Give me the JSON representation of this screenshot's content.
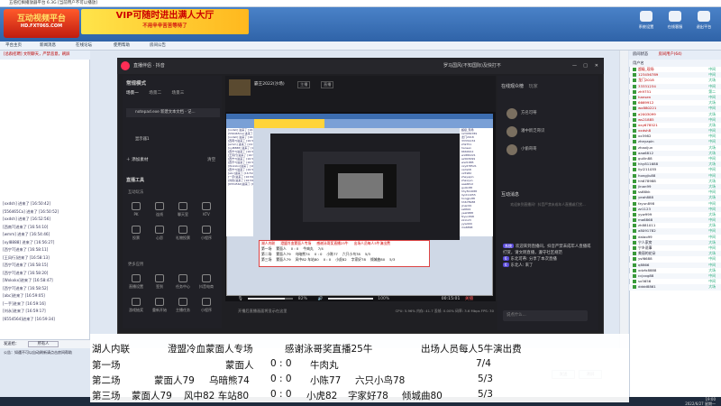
{
  "titlebar": {
    "text": "五倍红枫播放器平台 6.3G [当前用户不可以播放]"
  },
  "logo": {
    "text": "互动视频平台",
    "sub": "HD.FXT065.COM"
  },
  "banner": {
    "line1": "VIP可随时进出满人大厅",
    "line2": "不用辛辛苦苦等待了"
  },
  "top_buttons": [
    {
      "label": "系统设置"
    },
    {
      "label": "在线客服"
    },
    {
      "label": "退出平台"
    }
  ],
  "toolbar2": [
    {
      "label": "平台主页"
    },
    {
      "label": "新闻消息"
    },
    {
      "label": "在线论坛"
    },
    {
      "label": "使用帮助"
    },
    {
      "label": "房间公告"
    }
  ],
  "left": {
    "header": "[总群招聘] 文明聊天，严禁恶意，刷屏",
    "lines": [
      "[xxdsh] 进来了 [16:50:42]",
      "[556465Ca] 进来了 [16:50:52]",
      "[xxdsh] 进来了 [16:52:56]",
      "[西南7]进来了 [16:54:10]",
      "[wmm] 进来了 [16:54:46]",
      "[xyl8888] 进来了 [16:56:27]",
      "[西宁7]进来了 [16:58:11]",
      "[王风行]进来了 [16:58:13]",
      "[西宁7]进来了 [16:58:15]",
      "[西宁7]进来了 [16:58:20]",
      "[Wxkxkx]进来了 [16:58:47]",
      "[西宁7]进来了 [16:58:52]",
      "[abc]进来了 [16:59:05]",
      "[一手]进来了 [16:59:16]",
      "[刘永]进来了 [16:59:17]",
      "[6554564]进来了 [16:59:34]"
    ],
    "speaker_label": "发送给：",
    "speaker_value": "所有人",
    "info_label": "公告：如遇不可以自动刷新请点击房间帮助"
  },
  "right": {
    "tabs": [
      "房间状态",
      "房间用户(64)"
    ],
    "user_header": "用户名",
    "users": [
      {
        "name": "超级_现场",
        "status": "中间"
      },
      {
        "name": "123456789",
        "status": "中间"
      },
      {
        "name": "龙门2018",
        "status": "大场"
      },
      {
        "name": "33331234",
        "status": "中间"
      },
      {
        "name": "zh9751",
        "status": "第二"
      },
      {
        "name": "hansen",
        "status": "中间"
      },
      {
        "name": "6669912",
        "status": "大场"
      },
      {
        "name": "wx880221",
        "status": "中间"
      },
      {
        "name": "a2003099",
        "status": "大场"
      },
      {
        "name": "ws21885",
        "status": "中间"
      },
      {
        "name": "xxy678521",
        "status": "大场"
      },
      {
        "name": "xxdsh8",
        "status": "中间"
      },
      {
        "name": "xx5982",
        "status": "中间"
      },
      {
        "name": "zheyapin",
        "status": "中间"
      },
      {
        "name": "zhaxijun",
        "status": "大场"
      },
      {
        "name": "aaa6812",
        "status": "大场"
      },
      {
        "name": "guilin88",
        "status": "中间"
      },
      {
        "name": "hhy811688",
        "status": "大场"
      },
      {
        "name": "liyi211055",
        "status": "中间"
      },
      {
        "name": "hongjiu88",
        "status": "中间"
      },
      {
        "name": "hh678988",
        "status": "大场"
      },
      {
        "name": "jinan99",
        "status": "大场"
      },
      {
        "name": "ss66kk",
        "status": "中间"
      },
      {
        "name": "yeah888",
        "status": "大场"
      },
      {
        "name": "fzyun898",
        "status": "中间"
      },
      {
        "name": "zz1123",
        "status": "中间"
      },
      {
        "name": "yyw999",
        "status": "大场"
      },
      {
        "name": "ma6868",
        "status": "中间"
      },
      {
        "name": "zh881011",
        "status": "大场"
      },
      {
        "name": "a8091782",
        "status": "中间"
      },
      {
        "name": "dalao99",
        "status": "中间"
      },
      {
        "name": "宁人家房",
        "status": "大场"
      },
      {
        "name": "宁乡说事",
        "status": "中间"
      },
      {
        "name": "美丽的花朵",
        "status": "大场"
      },
      {
        "name": "ysf6688",
        "status": "中间"
      },
      {
        "name": "q8866",
        "status": "中间"
      },
      {
        "name": "xdzfx8888",
        "status": "大场"
      },
      {
        "name": "ccjxxg88",
        "status": "中间"
      },
      {
        "name": "sx5656",
        "status": "中间"
      },
      {
        "name": "dddd8861",
        "status": "大场"
      }
    ],
    "send_button": "发送",
    "clear_button": "清屏",
    "date": "2022/6/27 星期一",
    "time": "19:00"
  },
  "app": {
    "name": "直播伴侣 · 抖音",
    "user": "罗马国风(不知国际)及快打不",
    "left": {
      "scene_title": "常规模式",
      "scene_tabs": [
        "场景一",
        "场景二",
        "场景三"
      ],
      "sources": [
        "notepad.exe 新建文本文档 - 记...",
        "显示器1"
      ],
      "add_source": "添加素材",
      "clear": "清空",
      "tools_title": "直播工具",
      "interact_title": "互动玩法",
      "tools": [
        "PK",
        "连线",
        "聊天室",
        "KTV",
        "投票",
        "心愿",
        "礼物投票",
        "小程序"
      ],
      "more_title": "更多应用",
      "more": [
        "直播设置",
        "签到",
        "任务中心",
        "抖音电商",
        "游戏抽奖",
        "重新开始",
        "主播任务",
        "小程序"
      ]
    },
    "preview": {
      "room_name": "霸王2022(沙场)",
      "tag1": "主播",
      "tag2": "直播"
    },
    "controls": {
      "mic": "82%",
      "speaker": "100%",
      "timer": "00:15:01",
      "end": "关播"
    },
    "stats": "CPU: 5.96%  内存: 41.7  丢帧: 0.00%  码率: 3.6 Mbps  FPS: 30",
    "camera_hint": "开播后直播画面将显示在这里",
    "right": {
      "viewers_title": "在线观众榜",
      "viewers_tab2": "玩家",
      "viewers": [
        "方名可蒂",
        "潘中新泛哥识",
        "小偷哥哥"
      ],
      "messages_title": "互动消息",
      "messages_hint": "欢迎来到直播间！抖音严禁未成年人直播或打赏...",
      "messages": [
        {
          "tag": "系统",
          "text": "欢迎来到直播间，抖音严禁未成年人直播或打赏，请文明直播，遵守社区规范"
        },
        {
          "tag": "6",
          "text": "东北可蒂: 分享了本次直播"
        },
        {
          "tag": "6",
          "text": "东北人: 来了"
        }
      ],
      "input_hint": "说点什么..."
    }
  },
  "overlay": {
    "header": [
      "湖人内联",
      "澄盟冷血蒙面人专场",
      "感谢泳哥奖直播25牛",
      "出场人员每人5牛演出费"
    ],
    "rows": [
      {
        "label": "第一场",
        "a": "",
        "b": "蒙面人",
        "score": "0 : 0",
        "c": "牛肉丸",
        "d": "",
        "e": "",
        "f": "7/4"
      },
      {
        "label": "第二场",
        "a": "蒙面人79",
        "b": "乌暗熊74",
        "score": "0 : 0",
        "c": "小陈77",
        "d": "六只小鸟78",
        "e": "",
        "f": "5/3"
      },
      {
        "label": "第三场",
        "a": "蒙面人79",
        "b": "风中82 车站80",
        "score": "0 : 0",
        "c": "小虎82",
        "d": "字家好78",
        "e": "倾城曲80",
        "f": "5/3"
      }
    ]
  }
}
